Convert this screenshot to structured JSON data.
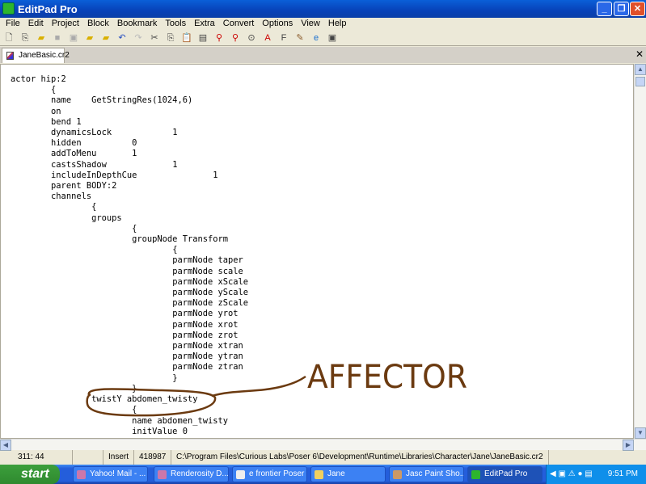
{
  "window": {
    "title": "EditPad Pro"
  },
  "menu": [
    "File",
    "Edit",
    "Project",
    "Block",
    "Bookmark",
    "Tools",
    "Extra",
    "Convert",
    "Options",
    "View",
    "Help"
  ],
  "tab": {
    "label": "JaneBasic.cr2"
  },
  "code": "actor hip:2\n\t{\n\tname\tGetStringRes(1024,6)\n\ton\n\tbend 1\n\tdynamicsLock\t\t1\n\thidden\t\t0\n\taddToMenu\t1\n\tcastsShadow\t\t1\n\tincludeInDepthCue\t\t1\n\tparent BODY:2\n\tchannels\n\t\t{\n\t\tgroups\n\t\t\t{\n\t\t\tgroupNode Transform\n\t\t\t\t{\n\t\t\t\tparmNode taper\n\t\t\t\tparmNode scale\n\t\t\t\tparmNode xScale\n\t\t\t\tparmNode yScale\n\t\t\t\tparmNode zScale\n\t\t\t\tparmNode yrot\n\t\t\t\tparmNode xrot\n\t\t\t\tparmNode zrot\n\t\t\t\tparmNode xtran\n\t\t\t\tparmNode ytran\n\t\t\t\tparmNode ztran\n\t\t\t\t}\n\t\t\t}\n\t\ttwistY abdomen_twisty\n\t\t\t{\n\t\t\tname abdomen_twisty\n\t\t\tinitValue 0",
  "annotation": "AFFECTOR",
  "status": {
    "position": "311: 44",
    "mode": "Insert",
    "size": "418987",
    "path": "C:\\Program Files\\Curious Labs\\Poser 6\\Development\\Runtime\\Libraries\\Character\\Jane\\JaneBasic.cr2"
  },
  "taskbar": {
    "start": "start",
    "tasks": [
      "Yahoo! Mail - ...",
      "Renderosity D...",
      "e frontier Poser",
      "Jane",
      "Jasc Paint Sho...",
      "EditPad Pro"
    ],
    "clock": "9:51 PM"
  }
}
